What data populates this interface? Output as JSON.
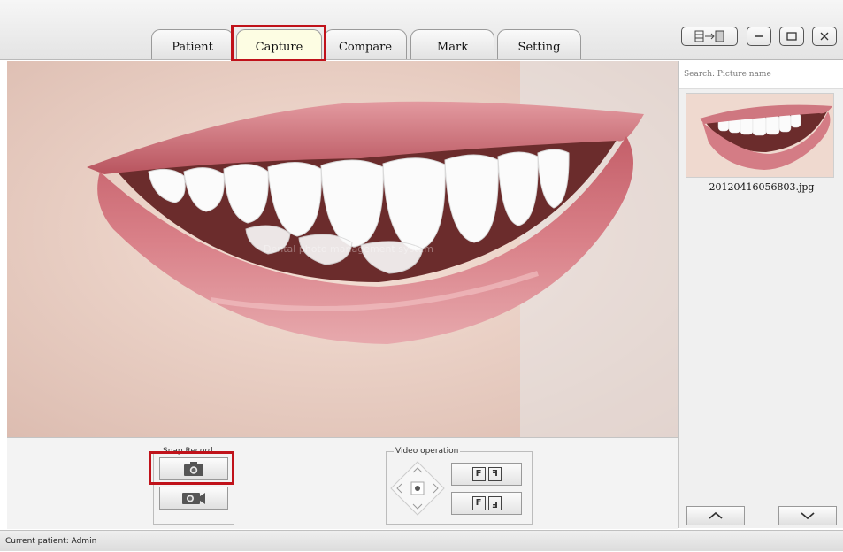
{
  "tabs": [
    {
      "label": "Patient",
      "active": false
    },
    {
      "label": "Capture",
      "active": true
    },
    {
      "label": "Compare",
      "active": false
    },
    {
      "label": "Mark",
      "active": false
    },
    {
      "label": "Setting",
      "active": false
    }
  ],
  "window_controls": [
    "sidebar-toggle-icon",
    "minimize-icon",
    "maximize-icon",
    "close-icon"
  ],
  "preview": {
    "watermark": "Dental photo management system"
  },
  "snap_record": {
    "label": "Snap Record",
    "icons": [
      "camera-icon",
      "video-camera-icon"
    ]
  },
  "video_operation": {
    "label": "Video operation",
    "icons": [
      "dpad-icon",
      "flip-horizontal-icon",
      "flip-vertical-icon"
    ]
  },
  "sidebar": {
    "search_placeholder": "Search: Picture name",
    "thumbnails": [
      {
        "filename": "20120416056803.jpg"
      }
    ],
    "nav_icons": [
      "chevron-up-icon",
      "chevron-down-icon"
    ]
  },
  "status": {
    "text": "Current patient: Admin"
  },
  "colors": {
    "highlight": "#c0121a",
    "active_tab": "#fdfde3",
    "lip": "#c96b73"
  }
}
